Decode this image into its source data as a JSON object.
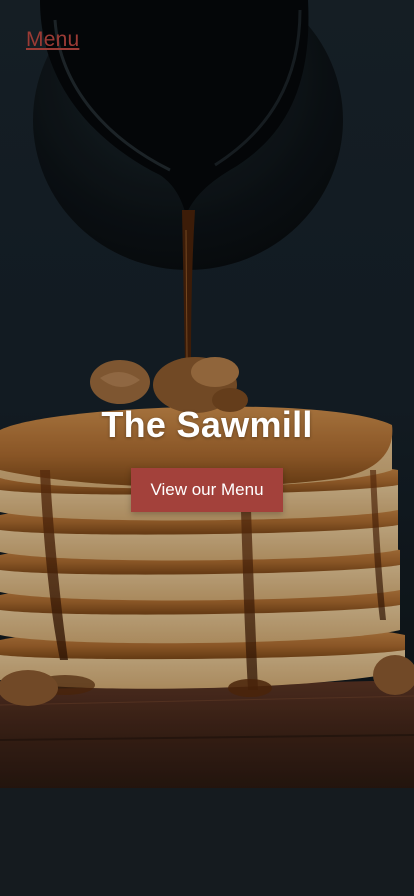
{
  "nav": {
    "menu_label": "Menu"
  },
  "hero": {
    "title": "The Sawmill",
    "cta_label": "View our Menu"
  },
  "colors": {
    "accent": "#a3413b",
    "link": "#9c3b35",
    "title_text": "#ffffff"
  }
}
